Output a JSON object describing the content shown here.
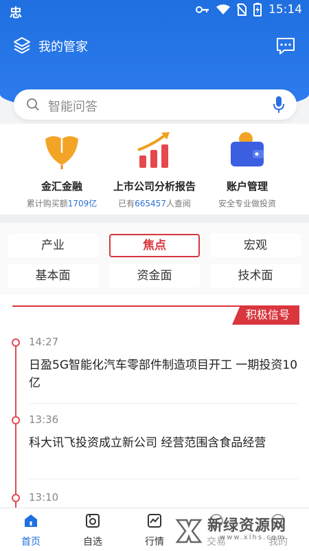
{
  "status": {
    "carrier_glyph": "忠",
    "time": "15:14"
  },
  "header": {
    "title": "我的管家"
  },
  "search": {
    "placeholder": "智能问答"
  },
  "features": [
    {
      "name": "金汇金融",
      "sub_prefix": "累计购买额",
      "sub_highlight": "1709亿",
      "sub_suffix": ""
    },
    {
      "name": "上市公司分析报告",
      "sub_prefix": "已有",
      "sub_highlight": "665457",
      "sub_suffix": "人查阅"
    },
    {
      "name": "账户管理",
      "sub_prefix": "安全专业做投资",
      "sub_highlight": "",
      "sub_suffix": ""
    }
  ],
  "categories": [
    {
      "label": "产业",
      "active": false
    },
    {
      "label": "焦点",
      "active": true
    },
    {
      "label": "宏观",
      "active": false
    },
    {
      "label": "基本面",
      "active": false
    },
    {
      "label": "资金面",
      "active": false
    },
    {
      "label": "技术面",
      "active": false
    }
  ],
  "feed": {
    "tag": "积极信号",
    "items": [
      {
        "time": "14:27",
        "title": "日盈5G智能化汽车零部件制造项目开工 一期投资10亿"
      },
      {
        "time": "13:36",
        "title": "科大讯飞投资成立新公司 经营范围含食品经营"
      },
      {
        "time": "13:10",
        "title": ""
      }
    ]
  },
  "tabs": [
    {
      "label": "首页",
      "icon": "home-icon",
      "active": true
    },
    {
      "label": "自选",
      "icon": "watchlist-icon",
      "active": false
    },
    {
      "label": "行情",
      "icon": "market-icon",
      "active": false
    },
    {
      "label": "交易",
      "icon": "trade-icon",
      "active": false
    },
    {
      "label": "我的",
      "icon": "profile-icon",
      "active": false
    }
  ],
  "watermark": {
    "text": "新绿资源网",
    "url": "www.xlhs.com"
  },
  "colors": {
    "primary": "#1f6fe0",
    "accent_red": "#d9363e",
    "gold": "#f0a020"
  }
}
